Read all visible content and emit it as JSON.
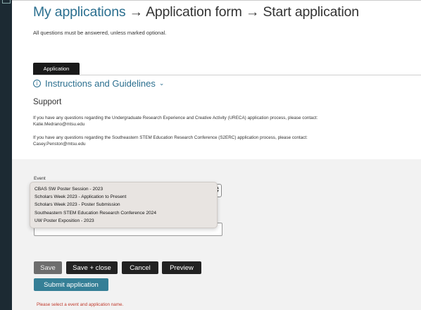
{
  "breadcrumb": {
    "items": [
      "My applications",
      "Application form",
      "Start application"
    ],
    "sep1": "→",
    "sep2": "→"
  },
  "note": "All questions must be answered, unless marked optional.",
  "tabs": [
    {
      "label": "Application"
    }
  ],
  "instructions": {
    "label": "Instructions and Guidelines",
    "icon": "info-icon",
    "chevron": "chevron-down-icon"
  },
  "support": {
    "heading": "Support",
    "para1_line1": "If you have any questions regarding the Undergraduate Research Experience and Creative Activity (URECA) application process, please contact:",
    "para1_line2": "Katie.Medrano@mtsu.edu",
    "para2_line1": "If you have any questions regarding the Southeastern STEM Education Research Conference (S2ERC) application process, please contact:",
    "para2_line2": "Casey.Penston@mtsu.edu"
  },
  "form": {
    "event_label": "Event",
    "event_options": [
      "CBAS SW Poster Session - 2023",
      "Scholars Week 2023 - Application to Present",
      "Scholars Week 2023 - Poster Submission",
      "Southeastern STEM Education Research Conference 2024",
      "UW Poster Exposition - 2023"
    ]
  },
  "buttons": {
    "save": "Save",
    "save_close": "Save + close",
    "cancel": "Cancel",
    "preview": "Preview",
    "submit": "Submit application"
  },
  "error": "Please select a event and application name.",
  "colors": {
    "link": "#2b6f8f",
    "submit": "#357f96",
    "error": "#c0392b",
    "sidebar": "#1c2a33"
  }
}
